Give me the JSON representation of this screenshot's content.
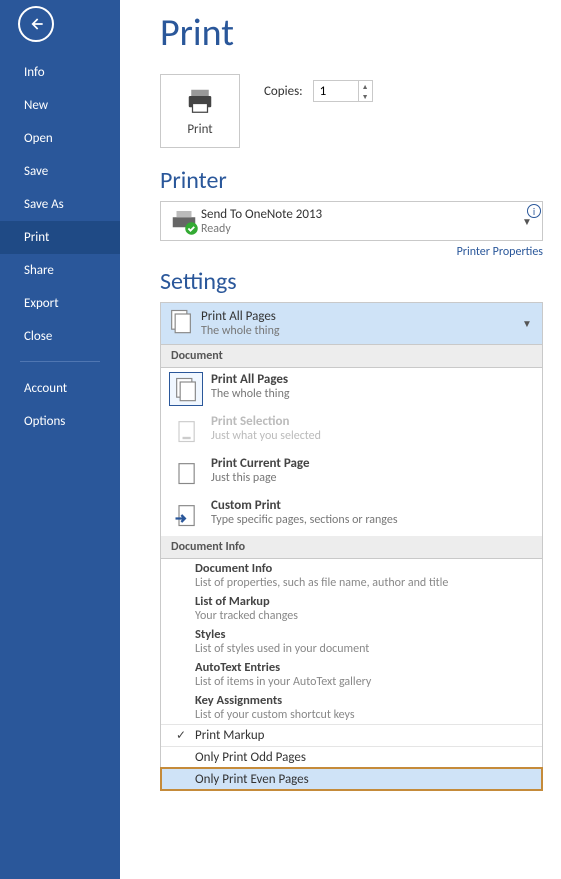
{
  "sidebar": {
    "items": [
      {
        "label": "Info"
      },
      {
        "label": "New"
      },
      {
        "label": "Open"
      },
      {
        "label": "Save"
      },
      {
        "label": "Save As"
      },
      {
        "label": "Print"
      },
      {
        "label": "Share"
      },
      {
        "label": "Export"
      },
      {
        "label": "Close"
      }
    ],
    "items2": [
      {
        "label": "Account"
      },
      {
        "label": "Options"
      }
    ]
  },
  "page": {
    "title": "Print",
    "print_button_label": "Print",
    "copies_label": "Copies:",
    "copies_value": "1"
  },
  "printer": {
    "section_title": "Printer",
    "selected_name": "Send To OneNote 2013",
    "selected_status": "Ready",
    "properties_link": "Printer Properties"
  },
  "settings": {
    "section_title": "Settings",
    "selected_title": "Print All Pages",
    "selected_sub": "The whole thing",
    "cat_document": "Document",
    "cat_docinfo": "Document Info",
    "options": [
      {
        "title": "Print All Pages",
        "sub": "The whole thing"
      },
      {
        "title": "Print Selection",
        "sub": "Just what you selected"
      },
      {
        "title": "Print Current Page",
        "sub": "Just this page"
      },
      {
        "title": "Custom Print",
        "sub": "Type specific pages, sections or ranges"
      }
    ],
    "info_options": [
      {
        "title": "Document Info",
        "sub": "List of properties, such as file name, author and title"
      },
      {
        "title": "List of Markup",
        "sub": "Your tracked changes"
      },
      {
        "title": "Styles",
        "sub": "List of styles used in your document"
      },
      {
        "title": "AutoText Entries",
        "sub": "List of items in your AutoText gallery"
      },
      {
        "title": "Key Assignments",
        "sub": "List of your custom shortcut keys"
      }
    ],
    "toggles": [
      {
        "label": "Print Markup",
        "checked": true
      },
      {
        "label": "Only Print Odd Pages",
        "checked": false
      },
      {
        "label": "Only Print Even Pages",
        "checked": false
      }
    ]
  }
}
